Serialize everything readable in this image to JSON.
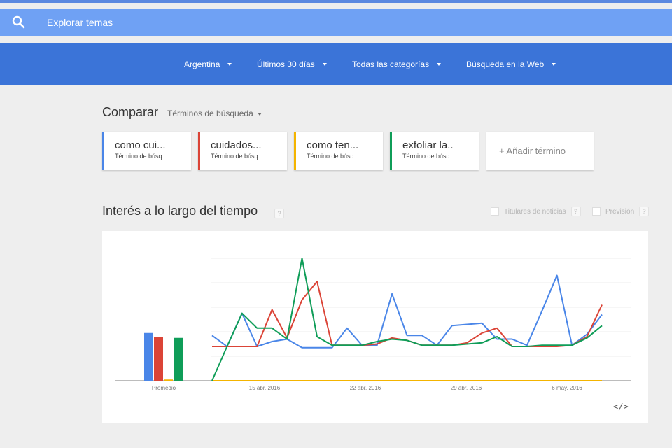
{
  "search": {
    "placeholder": "Explorar temas"
  },
  "filters": [
    {
      "label": "Argentina"
    },
    {
      "label": "Últimos 30 días"
    },
    {
      "label": "Todas las categorías"
    },
    {
      "label": "Búsqueda en la Web"
    }
  ],
  "compare": {
    "title": "Comparar",
    "mode_label": "Términos de búsqueda",
    "terms": [
      {
        "name": "como cui...",
        "sub": "Término de búsq...",
        "color": "#4a86e8"
      },
      {
        "name": "cuidados...",
        "sub": "Término de búsq...",
        "color": "#db4437"
      },
      {
        "name": "como ten...",
        "sub": "Término de búsq...",
        "color": "#f4b400"
      },
      {
        "name": "exfoliar la..",
        "sub": "Término de búsq...",
        "color": "#0f9d58"
      }
    ],
    "add_label": "+ Añadir término"
  },
  "interest": {
    "title": "Interés a lo largo del tiempo",
    "help": "?",
    "options": [
      {
        "label": "Titulares de noticias"
      },
      {
        "label": "Previsión"
      }
    ],
    "embed_label": "</>"
  },
  "chart_data": {
    "type": "line",
    "average_label": "Promedio",
    "ylim": [
      0,
      100
    ],
    "grid": true,
    "x_tick_labels": [
      "15 abr. 2016",
      "22 abr. 2016",
      "29 abr. 2016",
      "6 may. 2016"
    ],
    "averages": [
      {
        "color": "#4a86e8",
        "value": 39
      },
      {
        "color": "#db4437",
        "value": 36
      },
      {
        "color": "#f4b400",
        "value": 1
      },
      {
        "color": "#0f9d58",
        "value": 35
      }
    ],
    "series": [
      {
        "color": "#4a86e8",
        "values": [
          37,
          28,
          55,
          28,
          32,
          34,
          27,
          27,
          27,
          43,
          29,
          29,
          71,
          37,
          37,
          29,
          45,
          46,
          47,
          34,
          34,
          29,
          57,
          86,
          29,
          38,
          54
        ]
      },
      {
        "color": "#db4437",
        "values": [
          28,
          28,
          28,
          28,
          58,
          35,
          66,
          81,
          29,
          29,
          29,
          30,
          35,
          33,
          29,
          29,
          29,
          31,
          39,
          43,
          28,
          28,
          28,
          28,
          29,
          36,
          62
        ]
      },
      {
        "color": "#f4b400",
        "values": [
          0,
          0,
          0,
          0,
          0,
          0,
          0,
          0,
          0,
          0,
          0,
          0,
          0,
          0,
          0,
          0,
          0,
          0,
          0,
          0,
          0,
          0,
          0,
          0,
          0,
          0,
          0
        ]
      },
      {
        "color": "#0f9d58",
        "values": [
          0,
          28,
          55,
          43,
          43,
          34,
          100,
          36,
          29,
          29,
          29,
          32,
          34,
          33,
          29,
          29,
          29,
          30,
          31,
          36,
          28,
          28,
          29,
          29,
          29,
          35,
          45
        ]
      }
    ]
  }
}
